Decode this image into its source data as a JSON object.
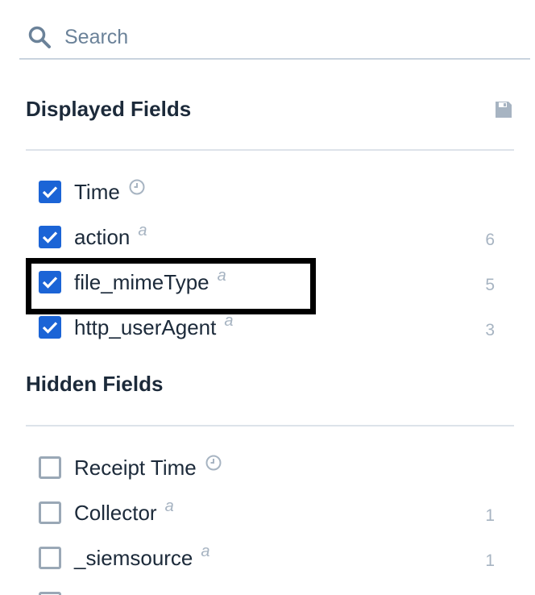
{
  "search": {
    "placeholder": "Search",
    "icon": "search-icon"
  },
  "displayed": {
    "title": "Displayed Fields",
    "save_icon": "save-icon",
    "fields": [
      {
        "name": "Time",
        "type": "clock",
        "count": "",
        "checked": true
      },
      {
        "name": "action",
        "type": "a",
        "count": "6",
        "checked": true
      },
      {
        "name": "file_mimeType",
        "type": "a",
        "count": "5",
        "checked": true
      },
      {
        "name": "http_userAgent",
        "type": "a",
        "count": "3",
        "checked": true
      }
    ]
  },
  "hidden": {
    "title": "Hidden Fields",
    "fields": [
      {
        "name": "Receipt Time",
        "type": "clock",
        "count": "",
        "checked": false
      },
      {
        "name": "Collector",
        "type": "a",
        "count": "1",
        "checked": false
      },
      {
        "name": "_siemsource",
        "type": "a",
        "count": "1",
        "checked": false
      }
    ]
  },
  "colors": {
    "accent": "#1b64d6",
    "highlight": "#000000"
  }
}
